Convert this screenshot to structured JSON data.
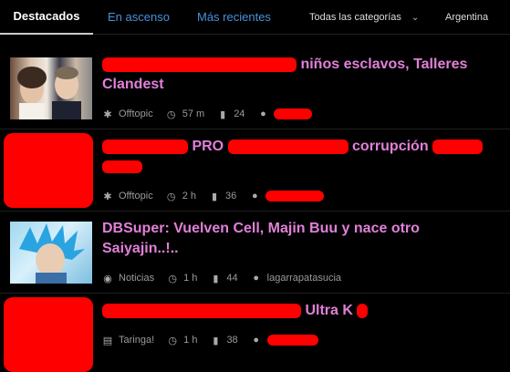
{
  "tabs": [
    {
      "label": "Destacados",
      "active": true
    },
    {
      "label": "En ascenso",
      "active": false
    },
    {
      "label": "Más recientes",
      "active": false
    }
  ],
  "filters": {
    "category": "Todas las categorías",
    "country": "Argentina"
  },
  "icons": {
    "category": "puzzle-icon",
    "time": "clock-icon",
    "comments": "comment-icon",
    "user": "user-icon"
  },
  "colors": {
    "title": "#e080d8",
    "active_tab": "#ffffff",
    "inactive_tab": "#4a90d9",
    "redaction": "#ff0000"
  },
  "posts": [
    {
      "title": "niños esclavos, Talleres Clandest",
      "category": "Offtopic",
      "time": "57 m",
      "comments": "24",
      "user": "",
      "redacted": [
        "title-prefix",
        "user"
      ]
    },
    {
      "title_parts": [
        "PRO",
        "corrupción"
      ],
      "category": "Offtopic",
      "time": "2 h",
      "comments": "36",
      "user": "",
      "redacted": [
        "thumbnail",
        "title",
        "user"
      ]
    },
    {
      "title": "DBSuper: Vuelven Cell, Majin Buu y nace otro Saiyajin..!..",
      "category": "Noticias",
      "time": "1 h",
      "comments": "44",
      "user": "lagarrapatasucia"
    },
    {
      "title": "Ultra K",
      "category": "Taringa!",
      "time": "1 h",
      "comments": "38",
      "user": "",
      "redacted": [
        "thumbnail",
        "title-prefix",
        "user"
      ]
    }
  ]
}
